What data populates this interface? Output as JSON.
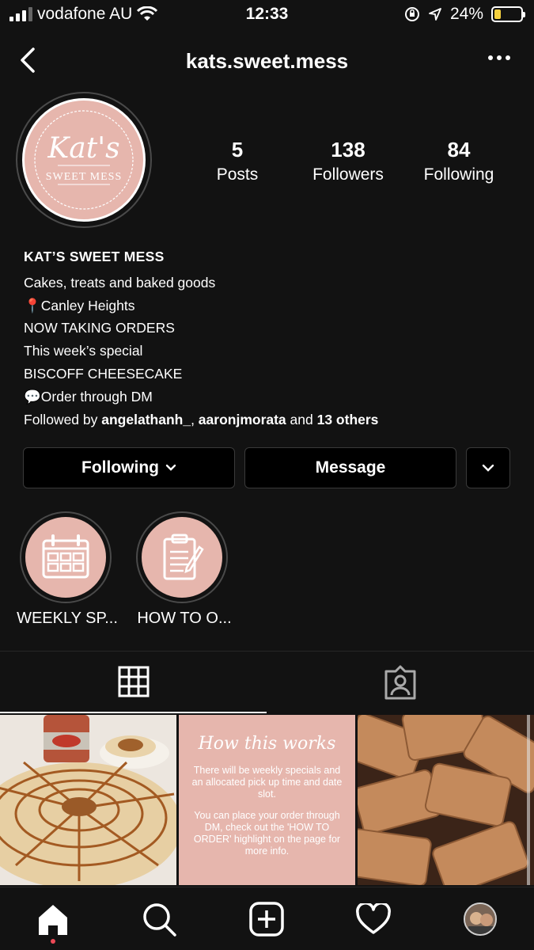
{
  "status_bar": {
    "carrier": "vodafone AU",
    "time": "12:33",
    "battery": "24%"
  },
  "header": {
    "username": "kats.sweet.mess"
  },
  "profile": {
    "avatar_text_script": "Kat's",
    "avatar_text_sub": "SWEET MESS",
    "stats": [
      {
        "value": "5",
        "label": "Posts"
      },
      {
        "value": "138",
        "label": "Followers"
      },
      {
        "value": "84",
        "label": "Following"
      }
    ]
  },
  "bio": {
    "name": "KAT’S SWEET MESS",
    "lines": [
      "Cakes, treats and baked goods",
      "📍Canley Heights",
      "NOW TAKING ORDERS",
      "This week’s special",
      "BISCOFF CHEESECAKE",
      "💬Order through DM"
    ],
    "followed_prefix": "Followed by ",
    "followed_user1": "angelathanh_",
    "followed_sep": ", ",
    "followed_user2": "aaronjmorata",
    "followed_and": " and ",
    "followed_others": "13 others"
  },
  "buttons": {
    "following": "Following",
    "message": "Message"
  },
  "highlights": [
    {
      "label": "WEEKLY SP...",
      "icon": "calendar-icon"
    },
    {
      "label": "HOW TO O...",
      "icon": "clipboard-icon"
    }
  ],
  "posts": [
    {
      "kind": "photo",
      "description_icon": "cheesecake-photo"
    },
    {
      "kind": "text",
      "title": "How this works",
      "para1": "There will be weekly specials and an allocated pick up time and date slot.",
      "para2": "You can place your order through DM, check out the 'HOW TO ORDER' highlight on the page for more info."
    },
    {
      "kind": "photo",
      "description_icon": "biscuits-photo"
    }
  ],
  "colors": {
    "background": "#121212",
    "brand_pink": "#e6b6ad",
    "notification_dot": "#ed4956"
  }
}
